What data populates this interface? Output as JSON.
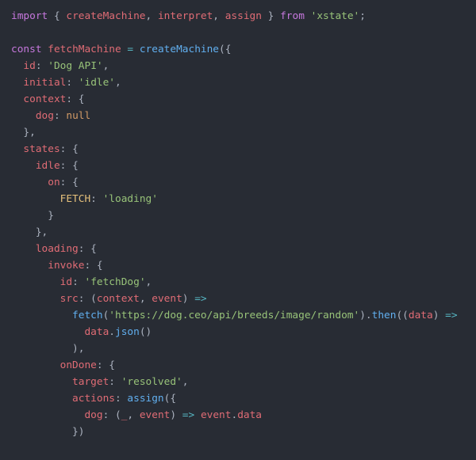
{
  "code": {
    "lines": [
      [
        {
          "cls": "c-kw",
          "t": "import"
        },
        {
          "cls": "c-def",
          "t": " { "
        },
        {
          "cls": "c-id",
          "t": "createMachine"
        },
        {
          "cls": "c-def",
          "t": ", "
        },
        {
          "cls": "c-id",
          "t": "interpret"
        },
        {
          "cls": "c-def",
          "t": ", "
        },
        {
          "cls": "c-id",
          "t": "assign"
        },
        {
          "cls": "c-def",
          "t": " } "
        },
        {
          "cls": "c-kw",
          "t": "from"
        },
        {
          "cls": "c-def",
          "t": " "
        },
        {
          "cls": "c-str",
          "t": "'xstate'"
        },
        {
          "cls": "c-def",
          "t": ";"
        }
      ],
      [],
      [
        {
          "cls": "c-kw",
          "t": "const"
        },
        {
          "cls": "c-def",
          "t": " "
        },
        {
          "cls": "c-id",
          "t": "fetchMachine"
        },
        {
          "cls": "c-def",
          "t": " "
        },
        {
          "cls": "c-op",
          "t": "="
        },
        {
          "cls": "c-def",
          "t": " "
        },
        {
          "cls": "c-fn",
          "t": "createMachine"
        },
        {
          "cls": "c-def",
          "t": "({"
        }
      ],
      [
        {
          "cls": "c-def",
          "t": "  "
        },
        {
          "cls": "c-key",
          "t": "id"
        },
        {
          "cls": "c-def",
          "t": ": "
        },
        {
          "cls": "c-str",
          "t": "'Dog API'"
        },
        {
          "cls": "c-def",
          "t": ","
        }
      ],
      [
        {
          "cls": "c-def",
          "t": "  "
        },
        {
          "cls": "c-key",
          "t": "initial"
        },
        {
          "cls": "c-def",
          "t": ": "
        },
        {
          "cls": "c-str",
          "t": "'idle'"
        },
        {
          "cls": "c-def",
          "t": ","
        }
      ],
      [
        {
          "cls": "c-def",
          "t": "  "
        },
        {
          "cls": "c-key",
          "t": "context"
        },
        {
          "cls": "c-def",
          "t": ": {"
        }
      ],
      [
        {
          "cls": "c-def",
          "t": "    "
        },
        {
          "cls": "c-key",
          "t": "dog"
        },
        {
          "cls": "c-def",
          "t": ": "
        },
        {
          "cls": "c-null",
          "t": "null"
        }
      ],
      [
        {
          "cls": "c-def",
          "t": "  },"
        }
      ],
      [
        {
          "cls": "c-def",
          "t": "  "
        },
        {
          "cls": "c-key",
          "t": "states"
        },
        {
          "cls": "c-def",
          "t": ": {"
        }
      ],
      [
        {
          "cls": "c-def",
          "t": "    "
        },
        {
          "cls": "c-key",
          "t": "idle"
        },
        {
          "cls": "c-def",
          "t": ": {"
        }
      ],
      [
        {
          "cls": "c-def",
          "t": "      "
        },
        {
          "cls": "c-key",
          "t": "on"
        },
        {
          "cls": "c-def",
          "t": ": {"
        }
      ],
      [
        {
          "cls": "c-def",
          "t": "        "
        },
        {
          "cls": "c-yel",
          "t": "FETCH"
        },
        {
          "cls": "c-def",
          "t": ": "
        },
        {
          "cls": "c-str",
          "t": "'loading'"
        }
      ],
      [
        {
          "cls": "c-def",
          "t": "      }"
        }
      ],
      [
        {
          "cls": "c-def",
          "t": "    },"
        }
      ],
      [
        {
          "cls": "c-def",
          "t": "    "
        },
        {
          "cls": "c-key",
          "t": "loading"
        },
        {
          "cls": "c-def",
          "t": ": {"
        }
      ],
      [
        {
          "cls": "c-def",
          "t": "      "
        },
        {
          "cls": "c-key",
          "t": "invoke"
        },
        {
          "cls": "c-def",
          "t": ": {"
        }
      ],
      [
        {
          "cls": "c-def",
          "t": "        "
        },
        {
          "cls": "c-key",
          "t": "id"
        },
        {
          "cls": "c-def",
          "t": ": "
        },
        {
          "cls": "c-str",
          "t": "'fetchDog'"
        },
        {
          "cls": "c-def",
          "t": ","
        }
      ],
      [
        {
          "cls": "c-def",
          "t": "        "
        },
        {
          "cls": "c-key",
          "t": "src"
        },
        {
          "cls": "c-def",
          "t": ": ("
        },
        {
          "cls": "c-id",
          "t": "context"
        },
        {
          "cls": "c-def",
          "t": ", "
        },
        {
          "cls": "c-id",
          "t": "event"
        },
        {
          "cls": "c-def",
          "t": ") "
        },
        {
          "cls": "c-op",
          "t": "=>"
        }
      ],
      [
        {
          "cls": "c-def",
          "t": "          "
        },
        {
          "cls": "c-fn",
          "t": "fetch"
        },
        {
          "cls": "c-def",
          "t": "("
        },
        {
          "cls": "c-str",
          "t": "'https://dog.ceo/api/breeds/image/random'"
        },
        {
          "cls": "c-def",
          "t": ")."
        },
        {
          "cls": "c-fn",
          "t": "then"
        },
        {
          "cls": "c-def",
          "t": "(("
        },
        {
          "cls": "c-id",
          "t": "data"
        },
        {
          "cls": "c-def",
          "t": ") "
        },
        {
          "cls": "c-op",
          "t": "=>"
        }
      ],
      [
        {
          "cls": "c-def",
          "t": "            "
        },
        {
          "cls": "c-id",
          "t": "data"
        },
        {
          "cls": "c-def",
          "t": "."
        },
        {
          "cls": "c-fn",
          "t": "json"
        },
        {
          "cls": "c-def",
          "t": "()"
        }
      ],
      [
        {
          "cls": "c-def",
          "t": "          ),"
        }
      ],
      [
        {
          "cls": "c-def",
          "t": "        "
        },
        {
          "cls": "c-key",
          "t": "onDone"
        },
        {
          "cls": "c-def",
          "t": ": {"
        }
      ],
      [
        {
          "cls": "c-def",
          "t": "          "
        },
        {
          "cls": "c-key",
          "t": "target"
        },
        {
          "cls": "c-def",
          "t": ": "
        },
        {
          "cls": "c-str",
          "t": "'resolved'"
        },
        {
          "cls": "c-def",
          "t": ","
        }
      ],
      [
        {
          "cls": "c-def",
          "t": "          "
        },
        {
          "cls": "c-key",
          "t": "actions"
        },
        {
          "cls": "c-def",
          "t": ": "
        },
        {
          "cls": "c-fn",
          "t": "assign"
        },
        {
          "cls": "c-def",
          "t": "({"
        }
      ],
      [
        {
          "cls": "c-def",
          "t": "            "
        },
        {
          "cls": "c-key",
          "t": "dog"
        },
        {
          "cls": "c-def",
          "t": ": ("
        },
        {
          "cls": "c-id",
          "t": "_"
        },
        {
          "cls": "c-def",
          "t": ", "
        },
        {
          "cls": "c-id",
          "t": "event"
        },
        {
          "cls": "c-def",
          "t": ") "
        },
        {
          "cls": "c-op",
          "t": "=>"
        },
        {
          "cls": "c-def",
          "t": " "
        },
        {
          "cls": "c-id",
          "t": "event"
        },
        {
          "cls": "c-def",
          "t": "."
        },
        {
          "cls": "c-id",
          "t": "data"
        }
      ],
      [
        {
          "cls": "c-def",
          "t": "          })"
        }
      ]
    ]
  }
}
